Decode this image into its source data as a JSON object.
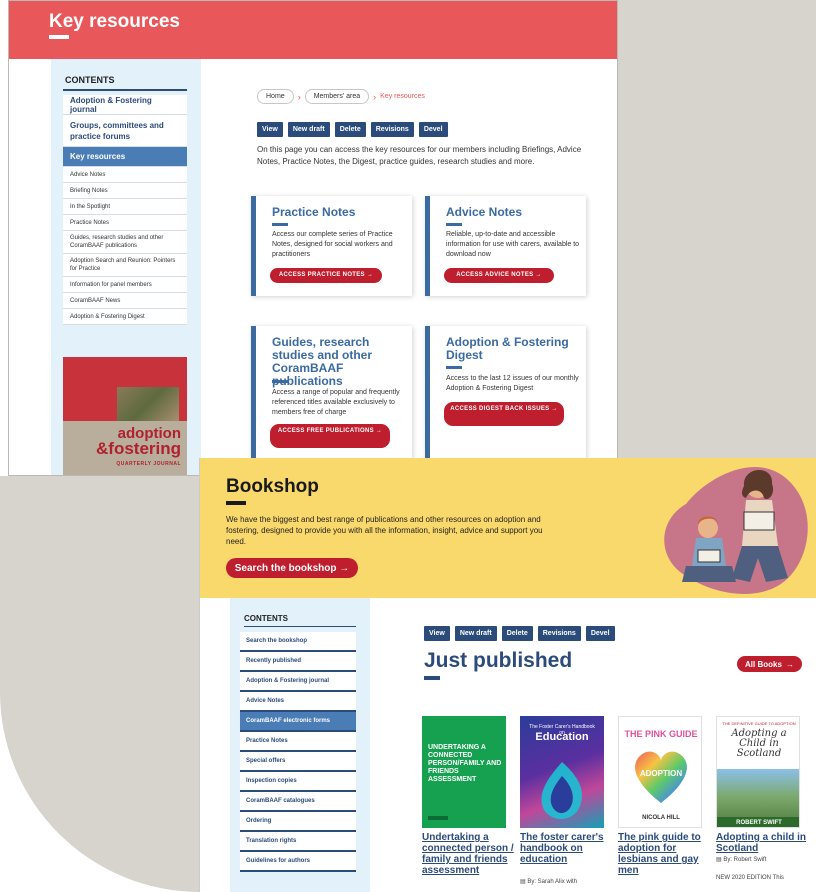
{
  "top": {
    "header_title": "Key resources",
    "contents_title": "CONTENTS",
    "sidebar_items": [
      "Adoption & Fostering journal",
      "Groups, committees and practice forums",
      "Key resources",
      "Advice Notes",
      "Briefing Notes",
      "In the Spotlight",
      "Practice Notes",
      "Guides, research studies and other CoramBAAF publications",
      "Adoption Search and Reunion: Pointers for Practice",
      "Information for panel members",
      "CoramBAAF News",
      "Adoption & Fostering Digest"
    ],
    "journal": {
      "word1": "adoption",
      "word2": "&fostering",
      "subtitle": "QUARTERLY JOURNAL"
    },
    "breadcrumb": [
      "Home",
      "Members' area",
      "Key resources"
    ],
    "tabs": [
      "View",
      "New draft",
      "Delete",
      "Revisions",
      "Devel"
    ],
    "intro": "On this page you can access the key resources for our members including Briefings, Advice Notes, Practice Notes, the Digest, practice guides, research studies and more.",
    "cards": [
      {
        "title": "Practice Notes",
        "text": "Access our complete series of Practice Notes, designed for social workers and practitioners",
        "button": "ACCESS PRACTICE NOTES →"
      },
      {
        "title": "Advice Notes",
        "text": "Reliable, up-to-date and accessible information for use with carers, available to download now",
        "button": "ACCESS ADVICE NOTES →"
      },
      {
        "title": "Guides, research studies and other CoramBAAF publications",
        "text": "Access a range of popular and frequently referenced titles available exclusively to members free of charge",
        "button": "ACCESS FREE PUBLICATIONS →"
      },
      {
        "title": "Adoption & Fostering Digest",
        "text": "Access to the last 12 issues of our monthly Adoption & Fostering Digest",
        "button": "ACCESS DIGEST BACK ISSUES →"
      }
    ]
  },
  "bottom": {
    "header_title": "Bookshop",
    "header_desc": "We have the biggest and best range of publications and other resources on adoption and fostering, designed to provide you with all the information, insight, advice and support you need.",
    "search_button": "Search the bookshop →",
    "contents_title": "CONTENTS",
    "sidebar_items": [
      "Search the bookshop",
      "Recently published",
      "Adoption & Fostering journal",
      "Advice Notes",
      "CoramBAAF electronic forms",
      "Practice Notes",
      "Special offers",
      "Inspection copies",
      "CoramBAAF catalogues",
      "Ordering",
      "Translation rights",
      "Guidelines for authors"
    ],
    "tabs": [
      "View",
      "New draft",
      "Delete",
      "Revisions",
      "Devel"
    ],
    "section_title": "Just published",
    "all_books_label": "All Books",
    "all_books_arrow": "→",
    "books": [
      {
        "title": "Undertaking a connected person / family and friends assessment",
        "cover_label": "UNDERTAKING A CONNECTED PERSON/FAMILY AND FRIENDS ASSESSMENT"
      },
      {
        "title": "The foster carer's handbook on education",
        "cover_label": "Education",
        "cover_top": "The Foster Carer's Handbook on",
        "author": "By: Sarah Alix with"
      },
      {
        "title": "The pink guide to adoption for lesbians and gay men",
        "cover_label": "THE PINK GUIDE",
        "cover_sub": "ADOPTION",
        "cover_author": "NICOLA HILL"
      },
      {
        "title": "Adopting a child in Scotland",
        "cover_top": "THE DEFINITIVE GUIDE TO ADOPTION",
        "cover_label": "Adopting a Child in Scotland",
        "cover_author": "ROBERT SWIFT",
        "author": "By: Robert Swift",
        "edition": "NEW 2020 EDITION This"
      }
    ]
  }
}
